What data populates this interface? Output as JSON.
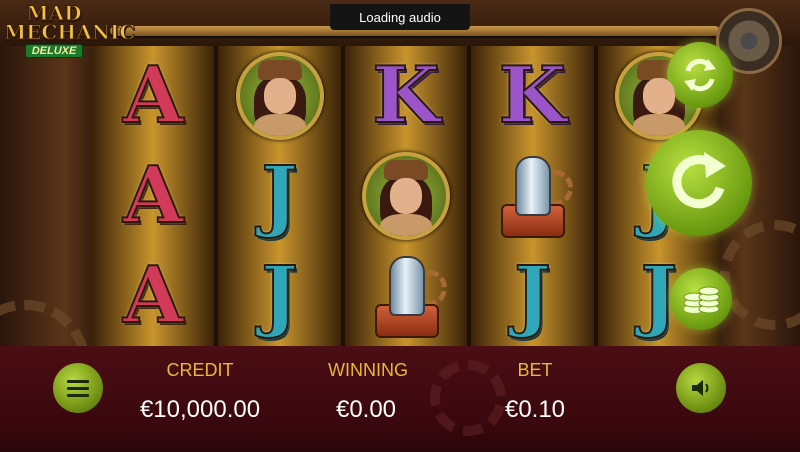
{
  "logo": {
    "line1": "MAD",
    "line2": "MECHANIC",
    "line3": "DELUXE"
  },
  "status": {
    "loading_text": "Loading audio"
  },
  "reels": [
    [
      "A",
      "A",
      "A"
    ],
    [
      "lady",
      "J",
      "J"
    ],
    [
      "K",
      "lady",
      "tube"
    ],
    [
      "K",
      "tube",
      "J"
    ],
    [
      "lady",
      "J",
      "J"
    ]
  ],
  "symbols": {
    "A": "A",
    "K": "K",
    "J": "J",
    "lady": "mechanic-lady-icon",
    "tube": "vacuum-tube-icon"
  },
  "controls": {
    "autoplay_icon": "autoplay-icon",
    "spin_icon": "spin-icon",
    "coins_icon": "coins-icon",
    "menu_icon": "menu-icon",
    "sound_icon": "speaker-icon"
  },
  "stats": {
    "credit_label": "CREDIT",
    "credit_value": "€10,000.00",
    "winning_label": "WINNING",
    "winning_value": "€0.00",
    "bet_label": "BET",
    "bet_value": "€0.10"
  },
  "colors": {
    "button_green": "#8cc41e",
    "label_gold": "#e8b83a",
    "bar_maroon": "#3a080e"
  }
}
